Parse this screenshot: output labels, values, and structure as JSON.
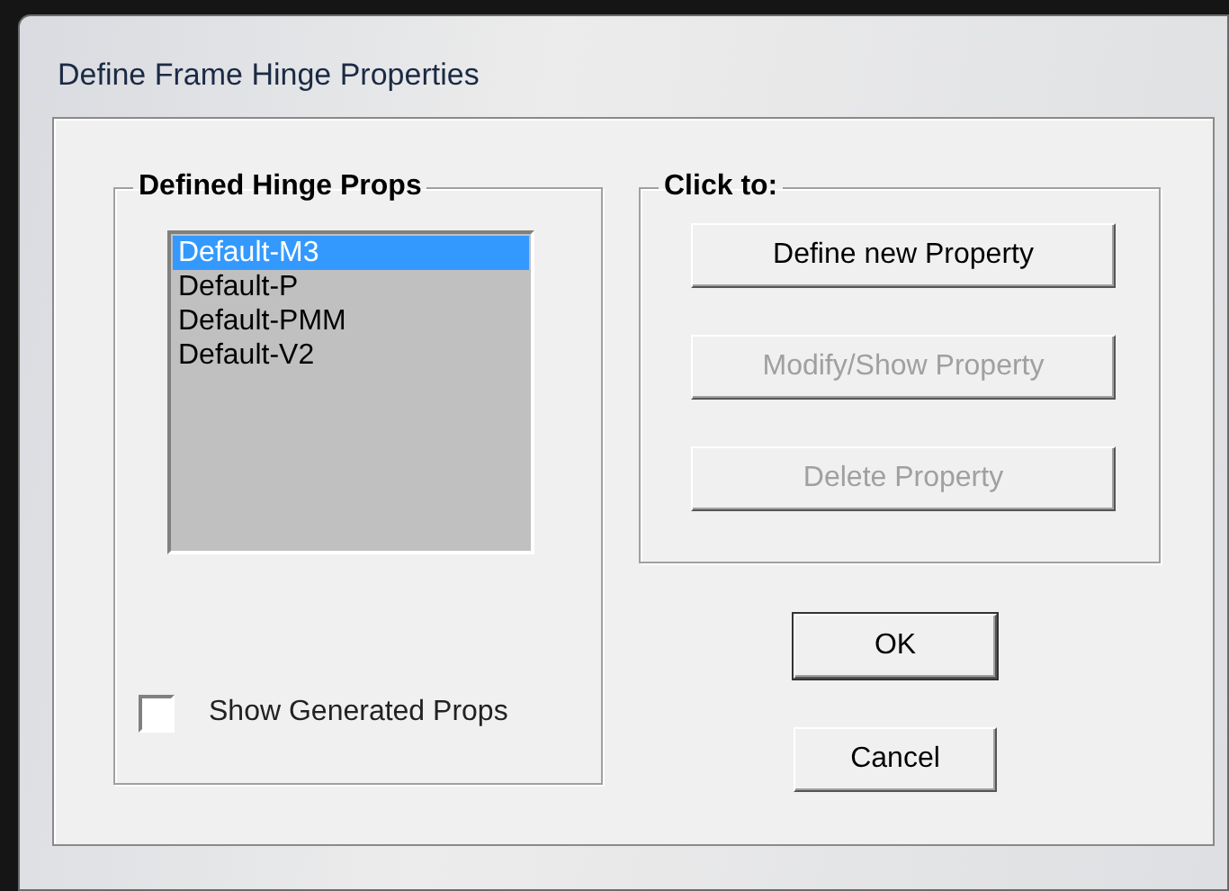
{
  "window": {
    "title": "Define Frame Hinge Properties"
  },
  "hinge_props": {
    "title": "Defined Hinge Props",
    "items": [
      {
        "label": "Default-M3",
        "selected": true
      },
      {
        "label": "Default-P",
        "selected": false
      },
      {
        "label": "Default-PMM",
        "selected": false
      },
      {
        "label": "Default-V2",
        "selected": false
      }
    ]
  },
  "show_generated": {
    "label": "Show Generated Props",
    "checked": false
  },
  "click_to": {
    "title": "Click to:",
    "buttons": [
      {
        "label": "Define new Property",
        "disabled": false
      },
      {
        "label": "Modify/Show Property",
        "disabled": true
      },
      {
        "label": "Delete Property",
        "disabled": true
      }
    ]
  },
  "buttons": [
    {
      "label": "OK",
      "default": true
    },
    {
      "label": "Cancel",
      "default": false
    }
  ]
}
